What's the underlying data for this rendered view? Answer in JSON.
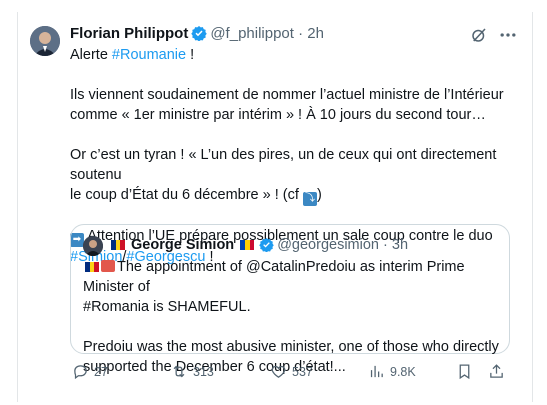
{
  "tweet": {
    "author_name": "Florian Philippot",
    "author_handle": "@f_philippot",
    "separator": "·",
    "time": "2h",
    "line1_prefix": "Alerte ",
    "line1_hashtag": "#Roumanie",
    "line1_suffix": " !",
    "para2_line1": "Ils viennent soudainement de nommer l’actuel ministre de l’Intérieur",
    "para2_line2": "comme « 1er ministre par intérim » ! À 10 jours du second tour…",
    "para3_line1": "Or c’est un tyran ! « L’un des pires, un de ceux qui ont directement soutenu",
    "para3_line2_prefix": "le coup d’État du 6 décembre » ! (cf ",
    "para3_line2_suffix": ")",
    "para4_text": " Attention l’UE prépare possiblement un sale coup contre le duo",
    "hashtag_simion": "#Simion",
    "slash": "/",
    "hashtag_georgescu": "#Georgescu",
    "para4_end": " !"
  },
  "quote": {
    "author_name": "George Simion",
    "author_handle": "@georgesimion",
    "separator": "·",
    "time": "3h",
    "line1": "The appointment of @CatalinPredoiu as interim Prime Minister of",
    "line2": "#Romania is SHAMEFUL.",
    "line3": "Predoiu was the most abusive minister, one of those who directly",
    "line4": "supported the December 6 coup d’état!..."
  },
  "actions": {
    "replies": "27",
    "reposts": "313",
    "likes": "537",
    "views": "9.8K"
  },
  "colors": {
    "accent": "#1d9bf0",
    "text": "#0f1419",
    "muted": "#536471",
    "border": "#cfd9de"
  },
  "icons": [
    "verified-badge-icon",
    "grok-icon",
    "more-icon",
    "reply-icon",
    "repost-icon",
    "like-icon",
    "views-icon",
    "bookmark-icon",
    "share-icon"
  ]
}
